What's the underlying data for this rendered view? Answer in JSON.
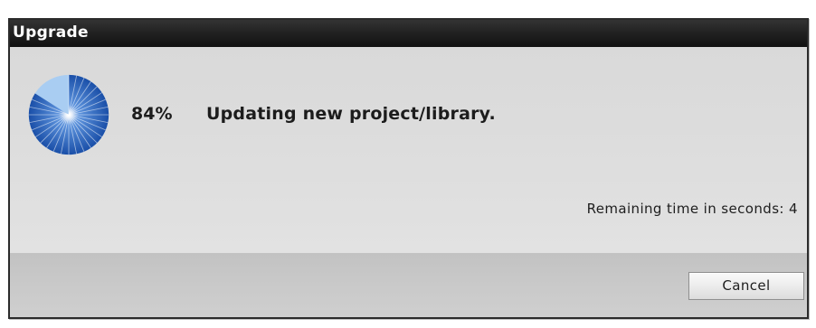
{
  "dialog": {
    "title": "Upgrade",
    "progress": {
      "percent_label": "84%",
      "fraction": 0.84,
      "status": "Updating new project/library."
    },
    "remaining_time": "Remaining time in seconds: 4",
    "cancel_label": "Cancel",
    "icon": "progress-pie-icon"
  },
  "colors": {
    "titlebar": "#1f1f1f",
    "title_text": "#ffffff",
    "body": "#dcdcdc",
    "footer": "#c8c8c8",
    "progress_fill": "#1a4fa8",
    "progress_remaining": "#a9cdf2"
  }
}
